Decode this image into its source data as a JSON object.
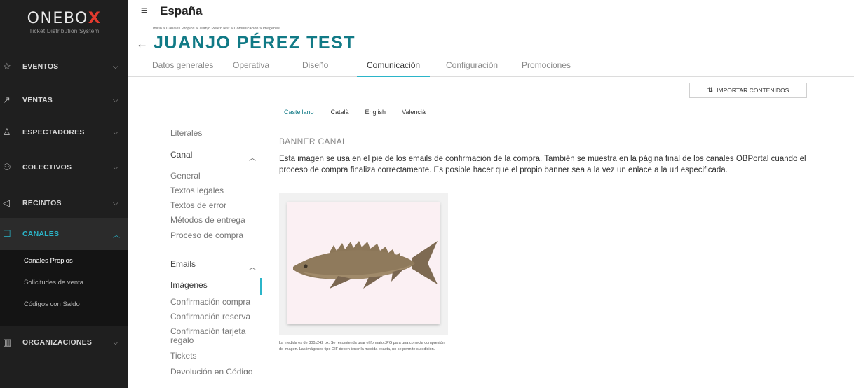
{
  "sidebar": {
    "logo": {
      "text": "ONEBO",
      "x_letter": "X",
      "subtitle": "Ticket Distribution System"
    },
    "items": [
      {
        "label": "EVENTOS",
        "icon": "star-icon",
        "chevron": "chevron-down-icon"
      },
      {
        "label": "VENTAS",
        "icon": "trend-icon",
        "chevron": "chevron-down-icon"
      },
      {
        "label": "ESPECTADORES",
        "icon": "user-icon",
        "chevron": "chevron-down-icon"
      },
      {
        "label": "COLECTIVOS",
        "icon": "group-icon",
        "chevron": "chevron-down-icon"
      },
      {
        "label": "RECINTOS",
        "icon": "location-icon",
        "chevron": "chevron-down-icon"
      },
      {
        "label": "CANALES",
        "icon": "channel-icon",
        "chevron": "chevron-up-icon"
      },
      {
        "label": "ORGANIZACIONES",
        "icon": "building-icon",
        "chevron": "chevron-down-icon"
      }
    ],
    "subitems": [
      "Canales Propios",
      "Solicitudes de venta",
      "Códigos con Saldo"
    ]
  },
  "header": {
    "title": "España",
    "breadcrumb": "Inicio > Canales Propios > Juanjo Pérez Test > Comunicación > Imágenes",
    "page_title": "JUANJO PÉREZ TEST"
  },
  "tabs": [
    "Datos generales",
    "Operativa",
    "Diseño",
    "Comunicación",
    "Configuración",
    "Promociones"
  ],
  "toolbar": {
    "import_label": "IMPORTAR CONTENIDOS"
  },
  "menu": {
    "literales": "Literales",
    "canal": "Canal",
    "canal_items": [
      "General",
      "Textos legales",
      "Textos de error",
      "Métodos de entrega",
      "Proceso de compra"
    ],
    "emails": "Emails",
    "email_items": [
      "Imágenes",
      "Confirmación compra",
      "Confirmación reserva",
      "Confirmación tarjeta regalo",
      "Tickets",
      "Devolución en Código"
    ]
  },
  "languages": [
    "Castellano",
    "Català",
    "English",
    "Valencià"
  ],
  "content": {
    "section_title": "BANNER CANAL",
    "description": "Esta imagen se usa en el pie de los emails de confirmación de la compra. También se muestra en la página final de los canales OBPortal cuando el proceso de compra finaliza correctamente. Es posible hacer que el propio banner sea a la vez un enlace a la url especificada.",
    "note": "La medida es de 300x242 px. Se recomienda usar el formato JPG para una correcta compresión de imagen. Las imágenes tipo GIF deben tener la medida exacta, no se permite su edición."
  },
  "colors": {
    "accent": "#2bb5c9",
    "title": "#117a86",
    "sidebar_bg": "#1f1f1f",
    "logo_x": "#e23a2e"
  }
}
